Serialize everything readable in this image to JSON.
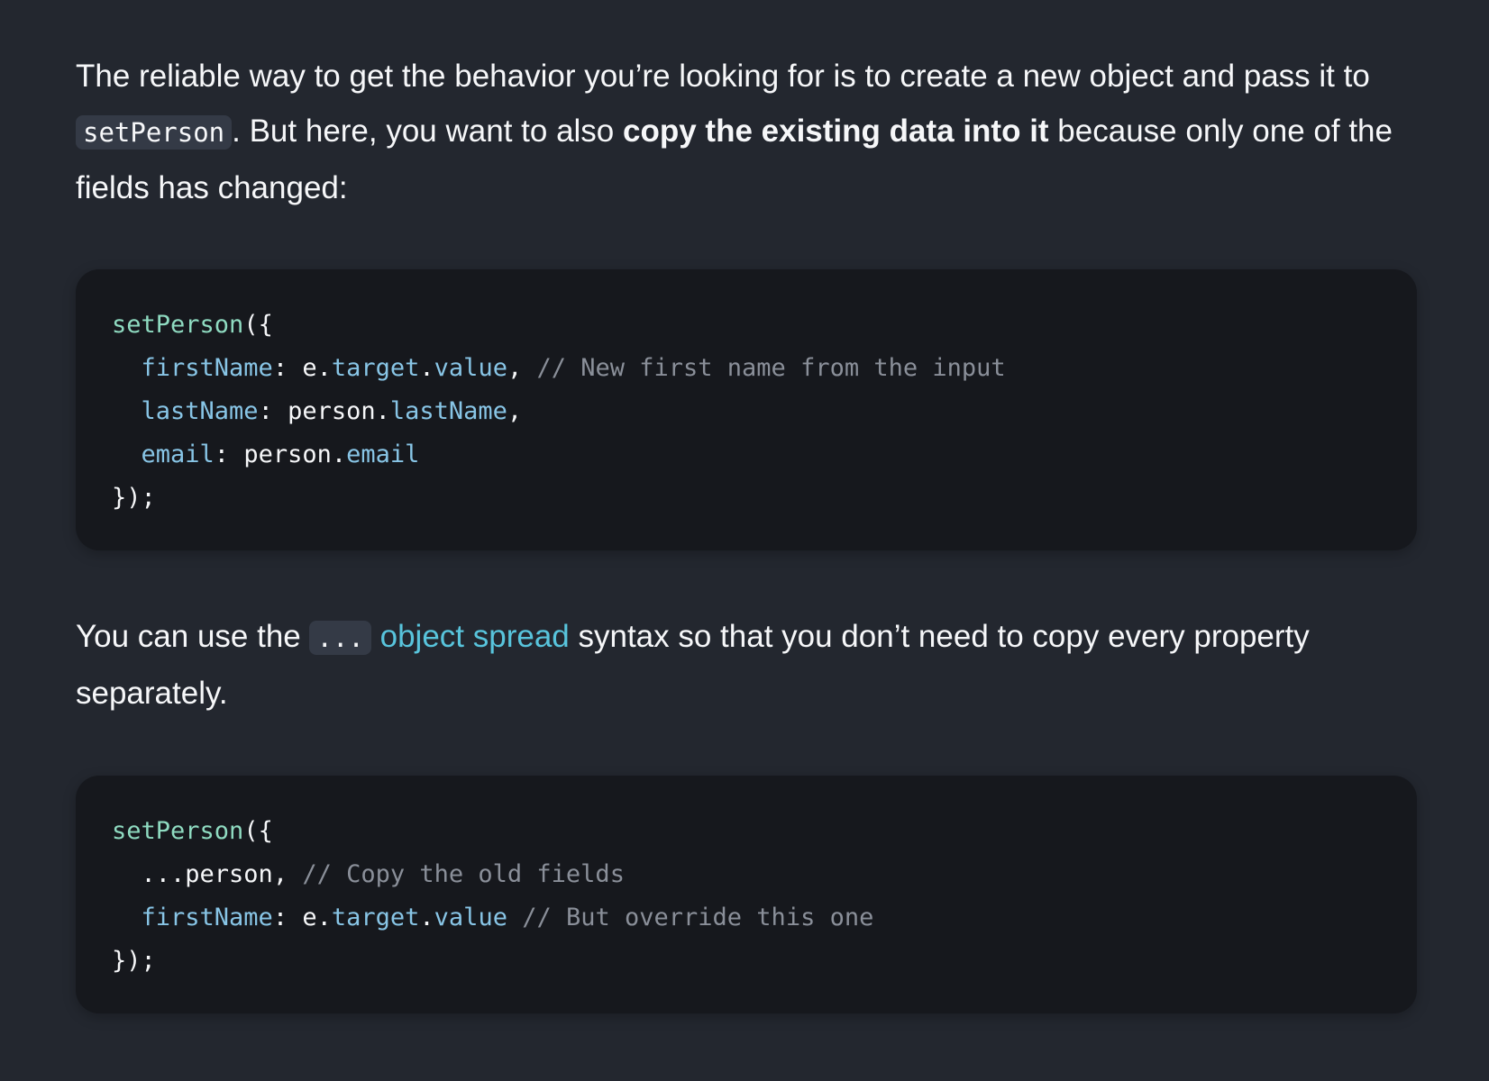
{
  "paragraph1": {
    "text_a": "The reliable way to get the behavior you’re looking for is to create a new object and pass it to ",
    "code": "setPerson",
    "text_b": ". But here, you want to also ",
    "bold": "copy the existing data into it",
    "text_c": " because only one of the fields has changed:"
  },
  "code_block1": {
    "line1": {
      "fn": "setPerson",
      "punct": "({"
    },
    "line2": {
      "indent": "  ",
      "key": "firstName",
      "colon": ": ",
      "obj": "e.",
      "p1": "target",
      "dot": ".",
      "p2": "value",
      "comma": ", ",
      "comment": "// New first name from the input"
    },
    "line3": {
      "indent": "  ",
      "key": "lastName",
      "colon": ": ",
      "obj": "person.",
      "p1": "lastName",
      "comma": ","
    },
    "line4": {
      "indent": "  ",
      "key": "email",
      "colon": ": ",
      "obj": "person.",
      "p1": "email"
    },
    "line5": {
      "text": "});"
    }
  },
  "paragraph2": {
    "text_a": "You can use the ",
    "code": "...",
    "link": "object spread",
    "text_b": " syntax so that you don’t need to copy every property separately."
  },
  "code_block2": {
    "line1": {
      "fn": "setPerson",
      "punct": "({"
    },
    "line2": {
      "indent": "  ",
      "text": "...person, ",
      "comment": "// Copy the old fields"
    },
    "line3": {
      "indent": "  ",
      "key": "firstName",
      "colon": ": ",
      "obj": "e.",
      "p1": "target",
      "dot": ".",
      "p2": "value",
      "space": " ",
      "comment": "// But override this one"
    },
    "line4": {
      "text": "});"
    }
  },
  "colors": {
    "background": "#23272f",
    "code_background": "#16181d",
    "function": "#8fdbc1",
    "property": "#88c5e6",
    "comment": "#8a8f99",
    "link": "#58c4dc"
  }
}
